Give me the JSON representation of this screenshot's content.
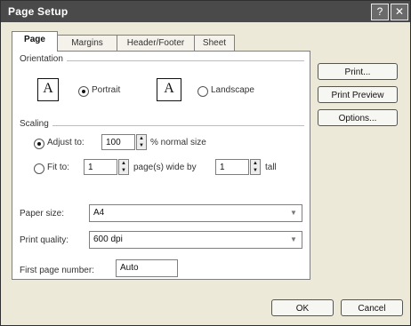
{
  "window": {
    "title": "Page Setup",
    "help_glyph": "?",
    "close_glyph": "✕"
  },
  "tabs": [
    {
      "label": "Page",
      "active": true
    },
    {
      "label": "Margins"
    },
    {
      "label": "Header/Footer"
    },
    {
      "label": "Sheet"
    }
  ],
  "orientation": {
    "label": "Orientation",
    "portrait_label": "Portrait",
    "landscape_label": "Landscape",
    "icon_glyph": "A",
    "selected": "portrait"
  },
  "scaling": {
    "label": "Scaling",
    "adjust_label": "Adjust to:",
    "adjust_value": "100",
    "adjust_suffix": "% normal size",
    "fit_label": "Fit to:",
    "fit_wide_value": "1",
    "fit_wide_suffix": "page(s) wide by",
    "fit_tall_value": "1",
    "fit_tall_suffix": "tall",
    "selected": "adjust"
  },
  "paper_size": {
    "label": "Paper size:",
    "value": "A4"
  },
  "print_quality": {
    "label": "Print quality:",
    "value": "600 dpi"
  },
  "first_page": {
    "label": "First page number:",
    "value": "Auto"
  },
  "side_buttons": {
    "print": "Print...",
    "preview": "Print Preview",
    "options": "Options..."
  },
  "footer": {
    "ok": "OK",
    "cancel": "Cancel"
  }
}
